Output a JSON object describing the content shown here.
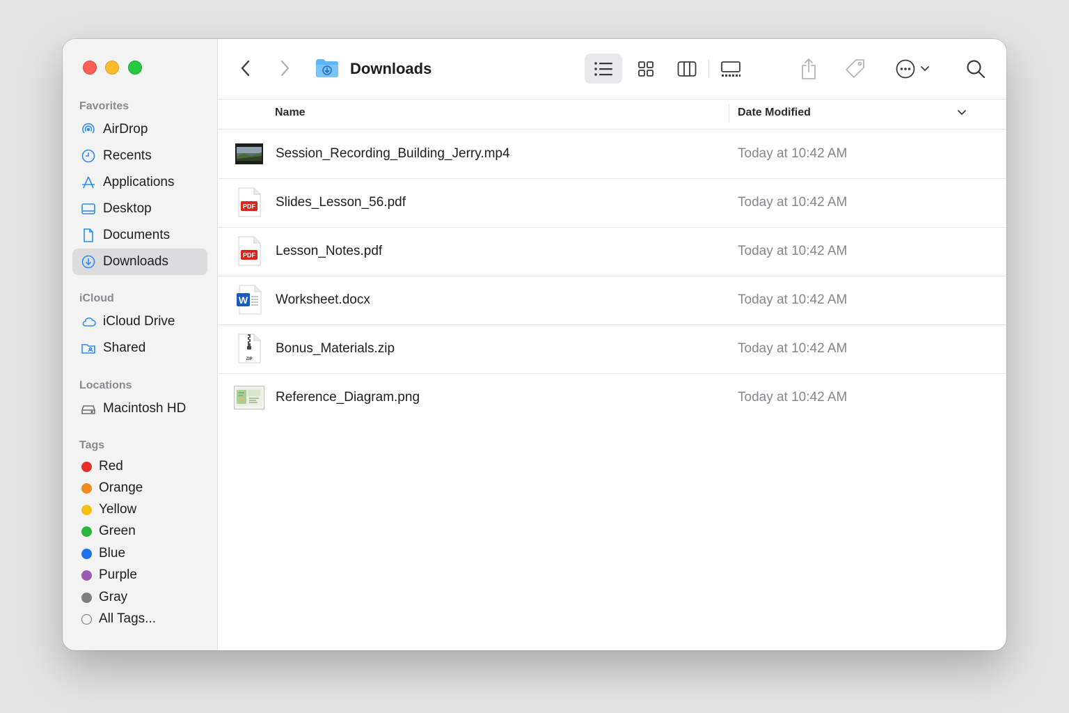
{
  "window": {
    "title": "Downloads"
  },
  "sidebar": {
    "favorites_title": "Favorites",
    "favorites": [
      {
        "label": "AirDrop",
        "icon": "airdrop-icon"
      },
      {
        "label": "Recents",
        "icon": "clock-icon"
      },
      {
        "label": "Applications",
        "icon": "applications-icon"
      },
      {
        "label": "Desktop",
        "icon": "desktop-icon"
      },
      {
        "label": "Documents",
        "icon": "document-icon"
      },
      {
        "label": "Downloads",
        "icon": "download-icon",
        "selected": true
      }
    ],
    "icloud_title": "iCloud",
    "icloud": [
      {
        "label": "iCloud Drive",
        "icon": "cloud-icon"
      },
      {
        "label": "Shared",
        "icon": "shared-folder-icon"
      }
    ],
    "locations_title": "Locations",
    "locations": [
      {
        "label": "Macintosh HD",
        "icon": "hard-drive-icon"
      }
    ],
    "tags_title": "Tags",
    "tags": [
      {
        "label": "Red",
        "color": "#e5302a"
      },
      {
        "label": "Orange",
        "color": "#f08a1c"
      },
      {
        "label": "Yellow",
        "color": "#f5c016"
      },
      {
        "label": "Green",
        "color": "#2ab540"
      },
      {
        "label": "Blue",
        "color": "#1a73e8"
      },
      {
        "label": "Purple",
        "color": "#9b59b6"
      },
      {
        "label": "Gray",
        "color": "#7d7d7d"
      },
      {
        "label": "All Tags...",
        "color": "none"
      }
    ]
  },
  "toolbar": {
    "accent": "#2d8cf0",
    "view_modes": [
      "list",
      "icons",
      "columns",
      "gallery"
    ],
    "active_view": "list"
  },
  "columns": {
    "name": "Name",
    "date": "Date Modified"
  },
  "files": [
    {
      "name": "Session_Recording_Building_Jerry.mp4",
      "date": "Today at 10:42 AM",
      "icon": "video-thumbnail-icon"
    },
    {
      "name": "Slides_Lesson_56.pdf",
      "date": "Today at 10:42 AM",
      "icon": "pdf-icon",
      "badge": "PDF"
    },
    {
      "name": "Lesson_Notes.pdf",
      "date": "Today at 10:42 AM",
      "icon": "pdf-icon",
      "badge": "PDF"
    },
    {
      "name": "Worksheet.docx",
      "date": "Today at 10:42 AM",
      "icon": "word-doc-icon",
      "badge": "W"
    },
    {
      "name": "Bonus_Materials.zip",
      "date": "Today at 10:42 AM",
      "icon": "zip-archive-icon",
      "badge": "ZIP"
    },
    {
      "name": "Reference_Diagram.png",
      "date": "Today at 10:42 AM",
      "icon": "image-thumbnail-icon"
    }
  ]
}
